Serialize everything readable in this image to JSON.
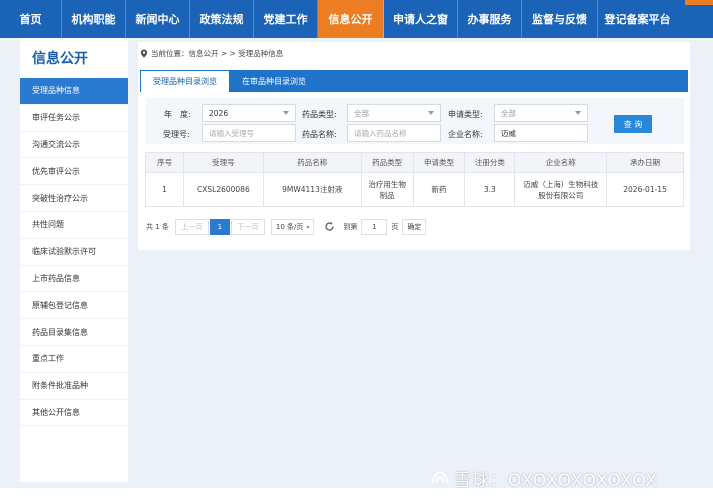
{
  "colors": {
    "nav": "#1b63b6",
    "active_nav": "#ec7d22",
    "accent": "#2a7ad1"
  },
  "nav": {
    "items": [
      "首页",
      "机构职能",
      "新闻中心",
      "政策法规",
      "党建工作",
      "信息公开",
      "申请人之窗",
      "办事服务",
      "监督与反馈",
      "登记备案平台"
    ],
    "active": "信息公开"
  },
  "sidebar": {
    "title": "信息公开",
    "items": [
      "受理品种信息",
      "审评任务公示",
      "沟通交流公示",
      "优先审评公示",
      "突破性治疗公示",
      "共性问题",
      "临床试验默示许可",
      "上市药品信息",
      "原辅包登记信息",
      "药品目录集信息",
      "重点工作",
      "附条件批准品种",
      "其他公开信息"
    ]
  },
  "breadcrumb": {
    "icon": "location-pin-icon",
    "prefix": "当前位置：",
    "path": "信息公开 > > 受理品种信息"
  },
  "tabs": [
    "受理品种目录浏览",
    "在审品种目录浏览"
  ],
  "filters": {
    "year_label": "年　度:",
    "year_value": "2026",
    "drug_type_label": "药品类型:",
    "drug_type_value": "全部",
    "apply_type_label": "申请类型:",
    "apply_type_value": "全部",
    "accept_no_label": "受理号:",
    "accept_no_placeholder": "请输入受理号",
    "drug_name_label": "药品名称:",
    "drug_name_placeholder": "请输入药品名称",
    "company_label": "企业名称:",
    "company_value": "迈威",
    "query_button": "查 询"
  },
  "table": {
    "headers": [
      "序号",
      "受理号",
      "药品名称",
      "药品类型",
      "申请类型",
      "注册分类",
      "企业名称",
      "承办日期"
    ],
    "rows": [
      [
        "1",
        "CXSL2600086",
        "9MW4113注射液",
        "治疗用生物制品",
        "新药",
        "3.3",
        "迈威（上海）生物科技股份有限公司",
        "2026-01-15"
      ]
    ]
  },
  "pager": {
    "total": "共 1 条",
    "prev": "上一页",
    "page": "1",
    "next": "下一页",
    "page_size": "10 条/页",
    "goto_prefix": "到第",
    "goto_value": "1",
    "goto_suffix": "页",
    "confirm": "确定"
  },
  "watermark": {
    "text": "雪球：OXOXOXOXOXOX"
  }
}
